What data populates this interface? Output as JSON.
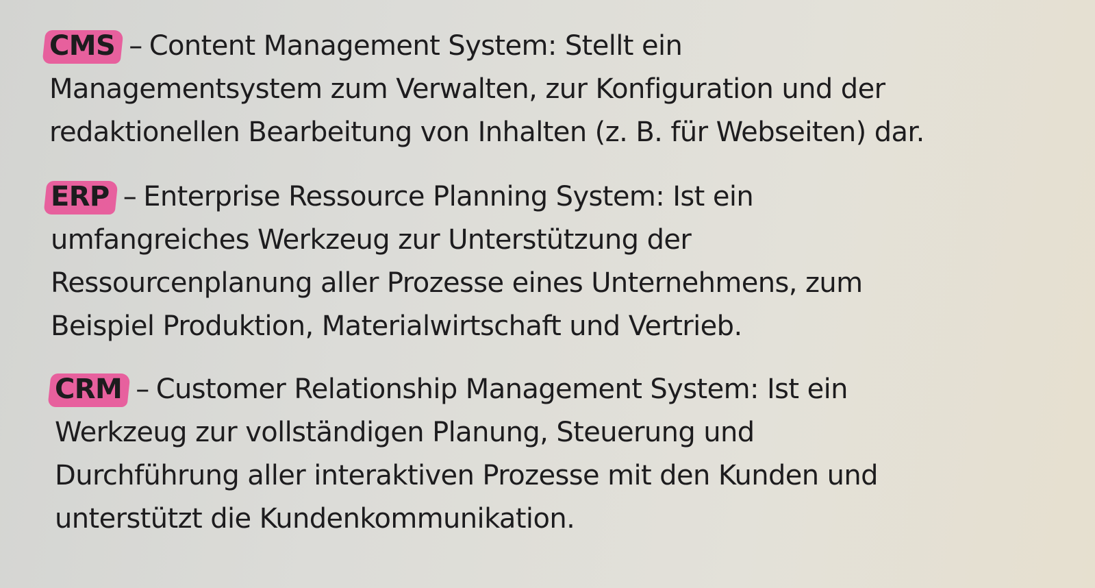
{
  "entries": [
    {
      "abbr": "CMS",
      "highlight_color": "#ec3f8e",
      "dash": "–",
      "lines": [
        "Content Management System: Stellt ein",
        "Managementsystem zum Verwalten, zur Konfiguration und der",
        "redaktionellen Bearbeitung von Inhalten (z. B. für Webseiten) dar."
      ]
    },
    {
      "abbr": "ERP",
      "highlight_color": "#ec3f8e",
      "dash": "–",
      "lines": [
        "Enterprise Ressource Planning System: Ist ein",
        "umfangreiches Werkzeug zur Unterstützung der",
        "Ressourcenplanung aller Prozesse eines Unternehmens, zum",
        "Beispiel Produktion, Materialwirtschaft und Vertrieb."
      ]
    },
    {
      "abbr": "CRM",
      "highlight_color": "#ec3f8e",
      "dash": "–",
      "lines": [
        "Customer Relationship Management System: Ist ein",
        "Werkzeug zur vollständigen Planung, Steuerung und",
        "Durchführung aller interaktiven Prozesse mit den Kunden und",
        "unterstützt die Kundenkommunikation."
      ]
    }
  ]
}
